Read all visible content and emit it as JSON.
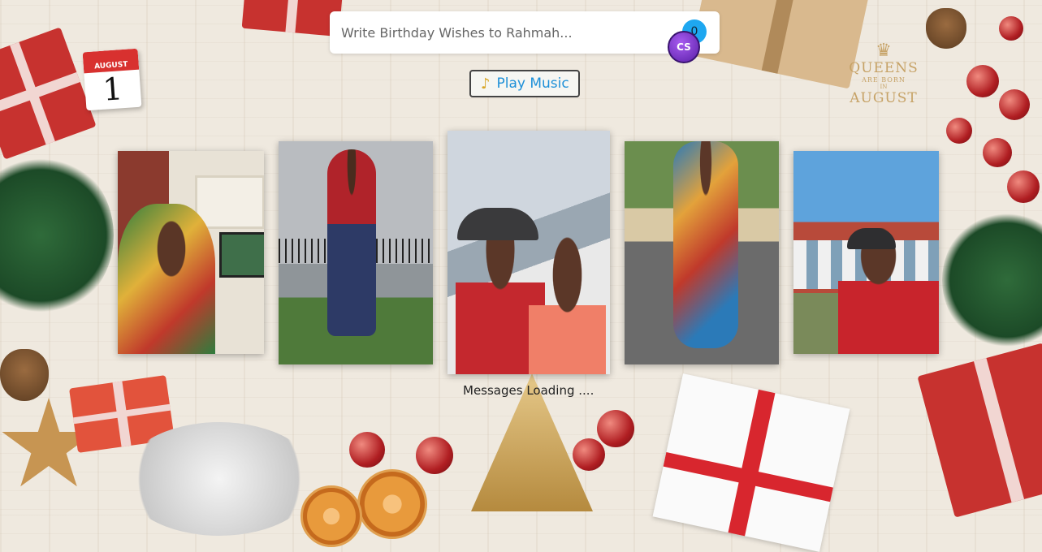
{
  "wish": {
    "placeholder": "Write Birthday Wishes to Rahmah...",
    "count": "0",
    "avatar_initials": "CS"
  },
  "music": {
    "label": "Play Music",
    "icon": "music-note-icon"
  },
  "calendar": {
    "month": "AUGUST",
    "day": "1"
  },
  "logo": {
    "line1": "QUEENS",
    "line2": "ARE BORN",
    "line3": "IN",
    "line4": "AUGUST"
  },
  "photos": [
    {
      "name": "photo-1",
      "bg": "#8b3a2e",
      "accent": "#2e7d3e"
    },
    {
      "name": "photo-2",
      "bg": "#b9bcc0",
      "accent": "#b0232a"
    },
    {
      "name": "photo-3",
      "bg": "#cfd6de",
      "accent": "#c4282e"
    },
    {
      "name": "photo-4",
      "bg": "#6b8e4e",
      "accent": "#2b7ab8"
    },
    {
      "name": "photo-5",
      "bg": "#5ea3dc",
      "accent": "#c8242c"
    }
  ],
  "status": {
    "loading": "Messages Loading ...."
  },
  "colors": {
    "accent": "#1e90d8",
    "badge": "#1ea7f0"
  }
}
